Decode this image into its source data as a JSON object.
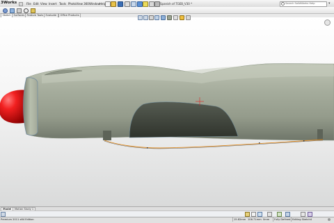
{
  "app": {
    "logo": "3Works"
  },
  "menu": [
    "File",
    "Edit",
    "View",
    "Insert",
    "Tools",
    "PhotoView 360",
    "Window",
    "Help"
  ],
  "document_title": "Spanish of TGEB_V30 *",
  "search": {
    "placeholder": "Search SolidWorks Help"
  },
  "command_tabs": [
    "Sketch",
    "Surfaces",
    "Feature Tools",
    "Evaluate",
    "Office Products"
  ],
  "active_command_tab": "Sketch",
  "bottom_tabs": [
    "Model",
    "Motion Study 1"
  ],
  "active_bottom_tab": "Model",
  "status": {
    "edition": "Premium 2011 x64 Edition",
    "x": "15.82mm",
    "y": "106.71mm",
    "z": "0mm",
    "definition": "Fully Defined",
    "mode": "Editing Sketch4"
  },
  "colors": {
    "fuselage": "#9aa291",
    "spinner": "#ef1818",
    "canopy": "#3e433b",
    "sketch_line": "#e08a1e"
  },
  "icons": [
    "new-icon",
    "open-icon",
    "save-icon",
    "print-icon",
    "undo-icon",
    "rebuild-icon",
    "options-icon",
    "search-icon",
    "zoom-fit-icon",
    "section-view-icon",
    "view-orientation-icon",
    "display-style-icon"
  ]
}
